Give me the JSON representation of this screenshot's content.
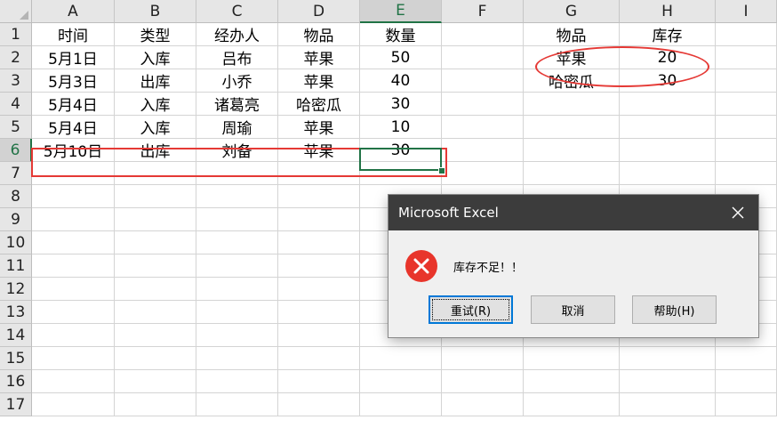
{
  "spreadsheet": {
    "columns": [
      "A",
      "B",
      "C",
      "D",
      "E",
      "F",
      "G",
      "H",
      "I"
    ],
    "selected_column": "E",
    "rows": [
      "1",
      "2",
      "3",
      "4",
      "5",
      "6",
      "7",
      "8",
      "9",
      "10",
      "11",
      "12",
      "13",
      "14",
      "15",
      "16",
      "17"
    ],
    "selected_row": "6",
    "cells": [
      {
        "ref": "A1",
        "col": 0,
        "row": 0,
        "value": "时间"
      },
      {
        "ref": "B1",
        "col": 1,
        "row": 0,
        "value": "类型"
      },
      {
        "ref": "C1",
        "col": 2,
        "row": 0,
        "value": "经办人"
      },
      {
        "ref": "D1",
        "col": 3,
        "row": 0,
        "value": "物品"
      },
      {
        "ref": "E1",
        "col": 4,
        "row": 0,
        "value": "数量"
      },
      {
        "ref": "G1",
        "col": 6,
        "row": 0,
        "value": "物品"
      },
      {
        "ref": "H1",
        "col": 7,
        "row": 0,
        "value": "库存"
      },
      {
        "ref": "A2",
        "col": 0,
        "row": 1,
        "value": "5月1日"
      },
      {
        "ref": "B2",
        "col": 1,
        "row": 1,
        "value": "入库"
      },
      {
        "ref": "C2",
        "col": 2,
        "row": 1,
        "value": "吕布"
      },
      {
        "ref": "D2",
        "col": 3,
        "row": 1,
        "value": "苹果"
      },
      {
        "ref": "E2",
        "col": 4,
        "row": 1,
        "value": "50"
      },
      {
        "ref": "G2",
        "col": 6,
        "row": 1,
        "value": "苹果"
      },
      {
        "ref": "H2",
        "col": 7,
        "row": 1,
        "value": "20"
      },
      {
        "ref": "A3",
        "col": 0,
        "row": 2,
        "value": "5月3日"
      },
      {
        "ref": "B3",
        "col": 1,
        "row": 2,
        "value": "出库"
      },
      {
        "ref": "C3",
        "col": 2,
        "row": 2,
        "value": "小乔"
      },
      {
        "ref": "D3",
        "col": 3,
        "row": 2,
        "value": "苹果"
      },
      {
        "ref": "E3",
        "col": 4,
        "row": 2,
        "value": "40"
      },
      {
        "ref": "G3",
        "col": 6,
        "row": 2,
        "value": "哈密瓜"
      },
      {
        "ref": "H3",
        "col": 7,
        "row": 2,
        "value": "30"
      },
      {
        "ref": "A4",
        "col": 0,
        "row": 3,
        "value": "5月4日"
      },
      {
        "ref": "B4",
        "col": 1,
        "row": 3,
        "value": "入库"
      },
      {
        "ref": "C4",
        "col": 2,
        "row": 3,
        "value": "诸葛亮"
      },
      {
        "ref": "D4",
        "col": 3,
        "row": 3,
        "value": "哈密瓜"
      },
      {
        "ref": "E4",
        "col": 4,
        "row": 3,
        "value": "30"
      },
      {
        "ref": "A5",
        "col": 0,
        "row": 4,
        "value": "5月4日"
      },
      {
        "ref": "B5",
        "col": 1,
        "row": 4,
        "value": "入库"
      },
      {
        "ref": "C5",
        "col": 2,
        "row": 4,
        "value": "周瑜"
      },
      {
        "ref": "D5",
        "col": 3,
        "row": 4,
        "value": "苹果"
      },
      {
        "ref": "E5",
        "col": 4,
        "row": 4,
        "value": "10"
      },
      {
        "ref": "A6",
        "col": 0,
        "row": 5,
        "value": "5月10日"
      },
      {
        "ref": "B6",
        "col": 1,
        "row": 5,
        "value": "出库"
      },
      {
        "ref": "C6",
        "col": 2,
        "row": 5,
        "value": "刘备"
      },
      {
        "ref": "D6",
        "col": 3,
        "row": 5,
        "value": "苹果"
      },
      {
        "ref": "E6",
        "col": 4,
        "row": 5,
        "value": "30"
      }
    ],
    "selection_color": "#217346",
    "annotation_color": "#e53935"
  },
  "dialog": {
    "title": "Microsoft Excel",
    "close_icon": "close-icon",
    "error_icon": "error-circle-x-icon",
    "message": "库存不足！！",
    "buttons": {
      "retry": "重试(R)",
      "cancel": "取消",
      "help": "帮助(H)"
    },
    "error_color": "#e8352b",
    "titlebar_color": "#3c3c3c"
  }
}
